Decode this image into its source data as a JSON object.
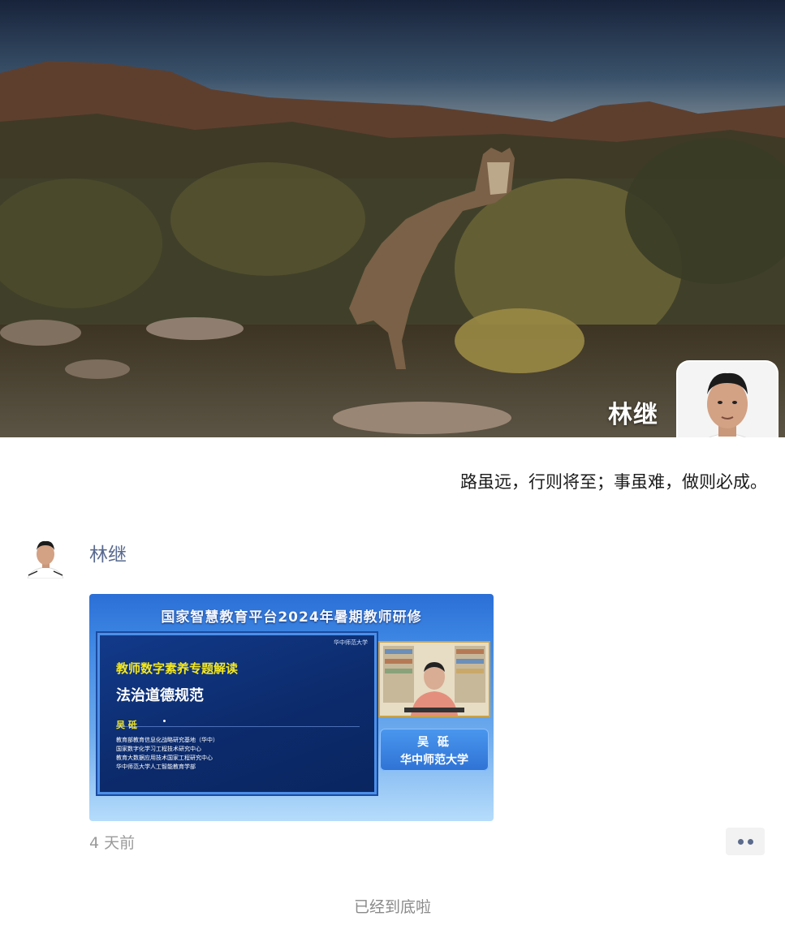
{
  "profile": {
    "name": "林继",
    "signature": "路虽远，行则将至；事虽难，做则必成。"
  },
  "post": {
    "author": "林继",
    "time": "4 天前",
    "image": {
      "title": "国家智慧教育平台2024年暑期教师研修",
      "logo_text": "华中师范大学",
      "topic": "教师数字素养专题解读",
      "subtitle": "法治道德规范",
      "speaker": "吴  砥",
      "affiliations": [
        "教育部教育信息化战略研究基地（华中）",
        "国家数字化学习工程技术研究中心",
        "教育大数据应用技术国家工程研究中心",
        "华中师范大学人工智能教育学部"
      ],
      "namecard_name": "吴  砥",
      "namecard_org": "华中师范大学"
    }
  },
  "footer": {
    "end_text": "已经到底啦"
  },
  "colors": {
    "author_link": "#57698f",
    "muted": "#9a9a9a"
  }
}
